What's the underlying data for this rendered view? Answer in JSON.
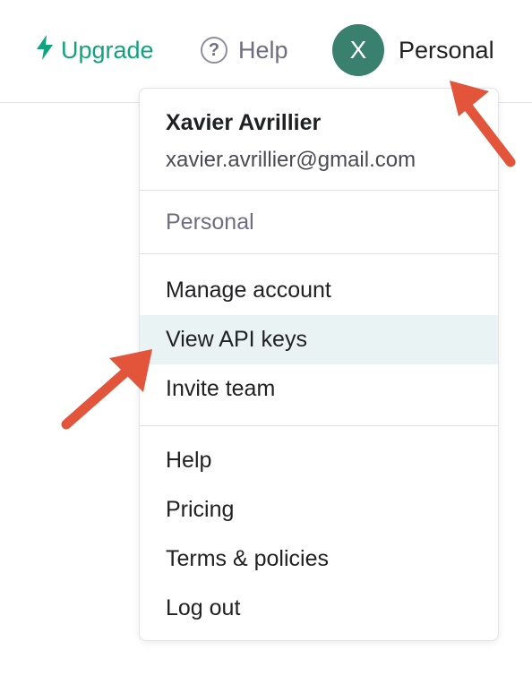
{
  "topbar": {
    "upgrade_label": "Upgrade",
    "help_label": "Help",
    "avatar_initial": "X",
    "account_label": "Personal"
  },
  "menu": {
    "user_name": "Xavier Avrillier",
    "user_email": "xavier.avrillier@gmail.com",
    "org_label": "Personal",
    "items_group1": [
      "Manage account",
      "View API keys",
      "Invite team"
    ],
    "items_group2": [
      "Help",
      "Pricing",
      "Terms & policies",
      "Log out"
    ],
    "highlighted_item": "View API keys"
  },
  "colors": {
    "accent": "#10a37f",
    "avatar_bg": "#39806e",
    "highlight_bg": "#e9f3f3",
    "annotation_arrow": "#e2553a"
  },
  "icons": {
    "upgrade": "lightning-bolt-icon",
    "help": "question-circle-icon"
  }
}
